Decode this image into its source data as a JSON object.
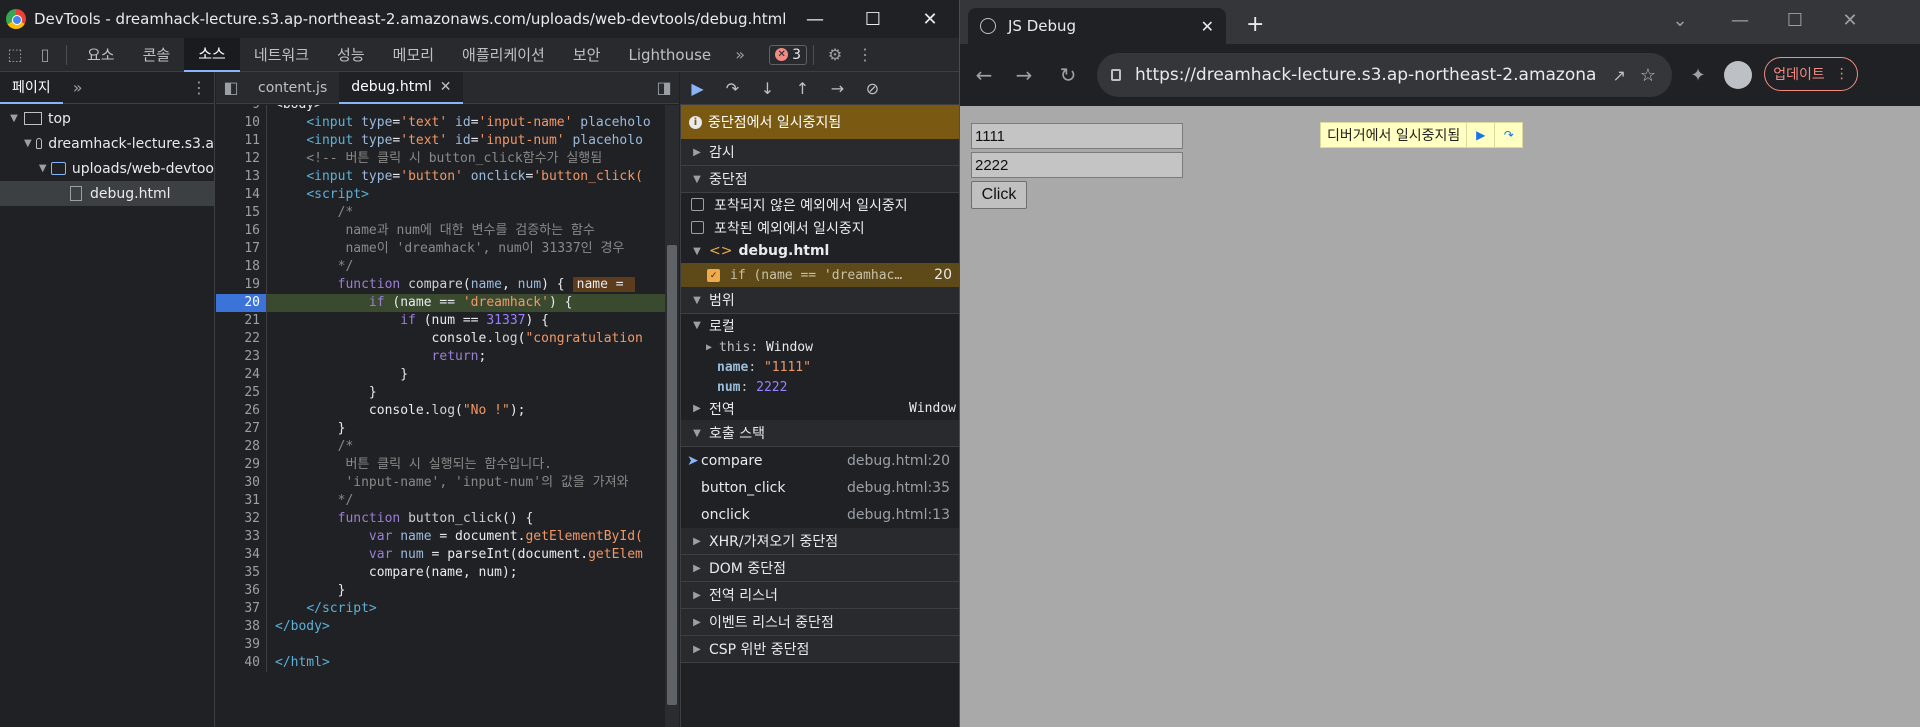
{
  "devtools": {
    "title": "DevTools - dreamhack-lecture.s3.ap-northeast-2.amazonaws.com/uploads/web-devtools/debug.html",
    "tabs": [
      "요소",
      "콘솔",
      "소스",
      "네트워크",
      "성능",
      "메모리",
      "애플리케이션",
      "보안",
      "Lighthouse"
    ],
    "active_tab": "소스",
    "error_count": "3",
    "navigator": {
      "tab": "페이지",
      "tree": [
        "top",
        "dreamhack-lecture.s3.a",
        "uploads/web-devtoo",
        "debug.html"
      ]
    },
    "editor": {
      "tabs": [
        "content.js",
        "debug.html"
      ],
      "active_tab": "debug.html",
      "inline_value": "name = "
    },
    "debugger": {
      "paused_banner": "중단점에서 일시중지됨",
      "sections": {
        "watch": "감시",
        "breakpoints": "중단점",
        "scope": "범위",
        "callstack": "호출 스택",
        "xhr": "XHR/가져오기 중단점",
        "dom": "DOM 중단점",
        "global_listeners": "전역 리스너",
        "event_listeners": "이벤트 리스너 중단점",
        "csp": "CSP 위반 중단점"
      },
      "pause_uncaught": "포착되지 않은 예외에서 일시중지",
      "pause_caught": "포착된 예외에서 일시중지",
      "bp_file": "debug.html",
      "bp_text": "if (name == 'dreamhac…",
      "bp_line": "20",
      "scope": {
        "local_label": "로컬",
        "this_key": "this",
        "this_val": "Window",
        "name_key": "name",
        "name_val": "\"1111\"",
        "num_key": "num",
        "num_val": "2222",
        "global_label": "전역",
        "global_val": "Window"
      },
      "callstack": [
        {
          "fn": "compare",
          "loc": "debug.html:20"
        },
        {
          "fn": "button_click",
          "loc": "debug.html:35"
        },
        {
          "fn": "onclick",
          "loc": "debug.html:13"
        }
      ]
    }
  },
  "browser": {
    "tab_title": "JS Debug",
    "url_host": "https://dreamhack-lecture.s3.ap-northeast-2.amazona...",
    "update_label": "업데이트",
    "page": {
      "input_name_value": "1111",
      "input_num_value": "2222",
      "button_label": "Click",
      "paused_text": "디버거에서 일시중지됨"
    }
  }
}
